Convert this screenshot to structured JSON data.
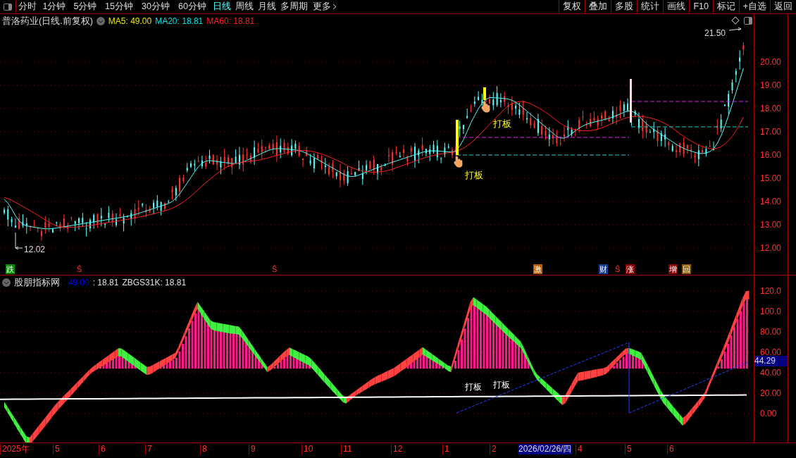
{
  "toolbar": {
    "periods": [
      {
        "label": "分时",
        "selected": false
      },
      {
        "label": "1分钟",
        "selected": false
      },
      {
        "label": "5分钟",
        "selected": false
      },
      {
        "label": "15分钟",
        "selected": false
      },
      {
        "label": "30分钟",
        "selected": false
      },
      {
        "label": "60分钟",
        "selected": false
      },
      {
        "label": "日线",
        "selected": true
      },
      {
        "label": "周线",
        "selected": false
      },
      {
        "label": "月线",
        "selected": false
      },
      {
        "label": "多周期",
        "selected": false
      },
      {
        "label": "更多",
        "selected": false
      }
    ],
    "buttons": [
      "复权",
      "叠加",
      "多股",
      "统计",
      "画线",
      "F10",
      "标记",
      "+自选",
      "返回"
    ]
  },
  "price_panel": {
    "title": "普洛药业(日线.前复权)",
    "indicators": [
      {
        "label": "MA5: 49.00",
        "color": "#e8e800"
      },
      {
        "label": "MA20: 18.81",
        "color": "#00e0e0"
      },
      {
        "label": "MA60: 18.81",
        "color": "#ff2020"
      }
    ],
    "high_label": "21.50",
    "low_label": "12.02",
    "annotations": [
      "打板",
      "打板"
    ],
    "event_markers": [
      {
        "label": "跌",
        "color": "#008a00"
      },
      {
        "label": "Ŝ",
        "color": "#000000"
      },
      {
        "label": "Ŝ",
        "color": "#000000"
      },
      {
        "label": "激",
        "color": "#b85c00"
      },
      {
        "label": "财",
        "color": "#1a3c8c"
      },
      {
        "label": "Ŝ",
        "color": "#000000"
      },
      {
        "label": "涨",
        "color": "#8c0000"
      },
      {
        "label": "增",
        "color": "#8c0000"
      },
      {
        "label": "回",
        "color": "#8c5c00"
      }
    ],
    "yticks": [
      "20.00",
      "19.00",
      "18.00",
      "17.00",
      "16.00",
      "15.00",
      "14.00",
      "13.00",
      "12.00"
    ]
  },
  "indicator_panel": {
    "name": "股朋指标网",
    "values": [
      {
        "label": ": 49.00",
        "color": "#0000ff"
      },
      {
        "label": ": 18.81",
        "color": "#e0e0e0"
      },
      {
        "label": "ZBGS31K: 18.81",
        "color": "#e0e0e0"
      }
    ],
    "annotations": [
      "打板",
      "打板"
    ],
    "current_value": "44.29",
    "yticks": [
      "120.0",
      "100.0",
      "80.00",
      "60.00",
      "40.00",
      "20.00",
      "0.00"
    ]
  },
  "time_axis": [
    {
      "label": "2025年",
      "kind": "month"
    },
    {
      "label": "5",
      "kind": "month"
    },
    {
      "label": "6",
      "kind": "month"
    },
    {
      "label": "7",
      "kind": "month"
    },
    {
      "label": "8",
      "kind": "month"
    },
    {
      "label": "9",
      "kind": "month"
    },
    {
      "label": "10",
      "kind": "month"
    },
    {
      "label": "11",
      "kind": "month"
    },
    {
      "label": "12",
      "kind": "month"
    },
    {
      "label": "1",
      "kind": "month"
    },
    {
      "label": "2",
      "kind": "month"
    },
    {
      "label": "2026/02/26/四",
      "kind": "cursor"
    },
    {
      "label": "4",
      "kind": "month"
    },
    {
      "label": "5",
      "kind": "month"
    },
    {
      "label": "6",
      "kind": "month"
    }
  ]
}
